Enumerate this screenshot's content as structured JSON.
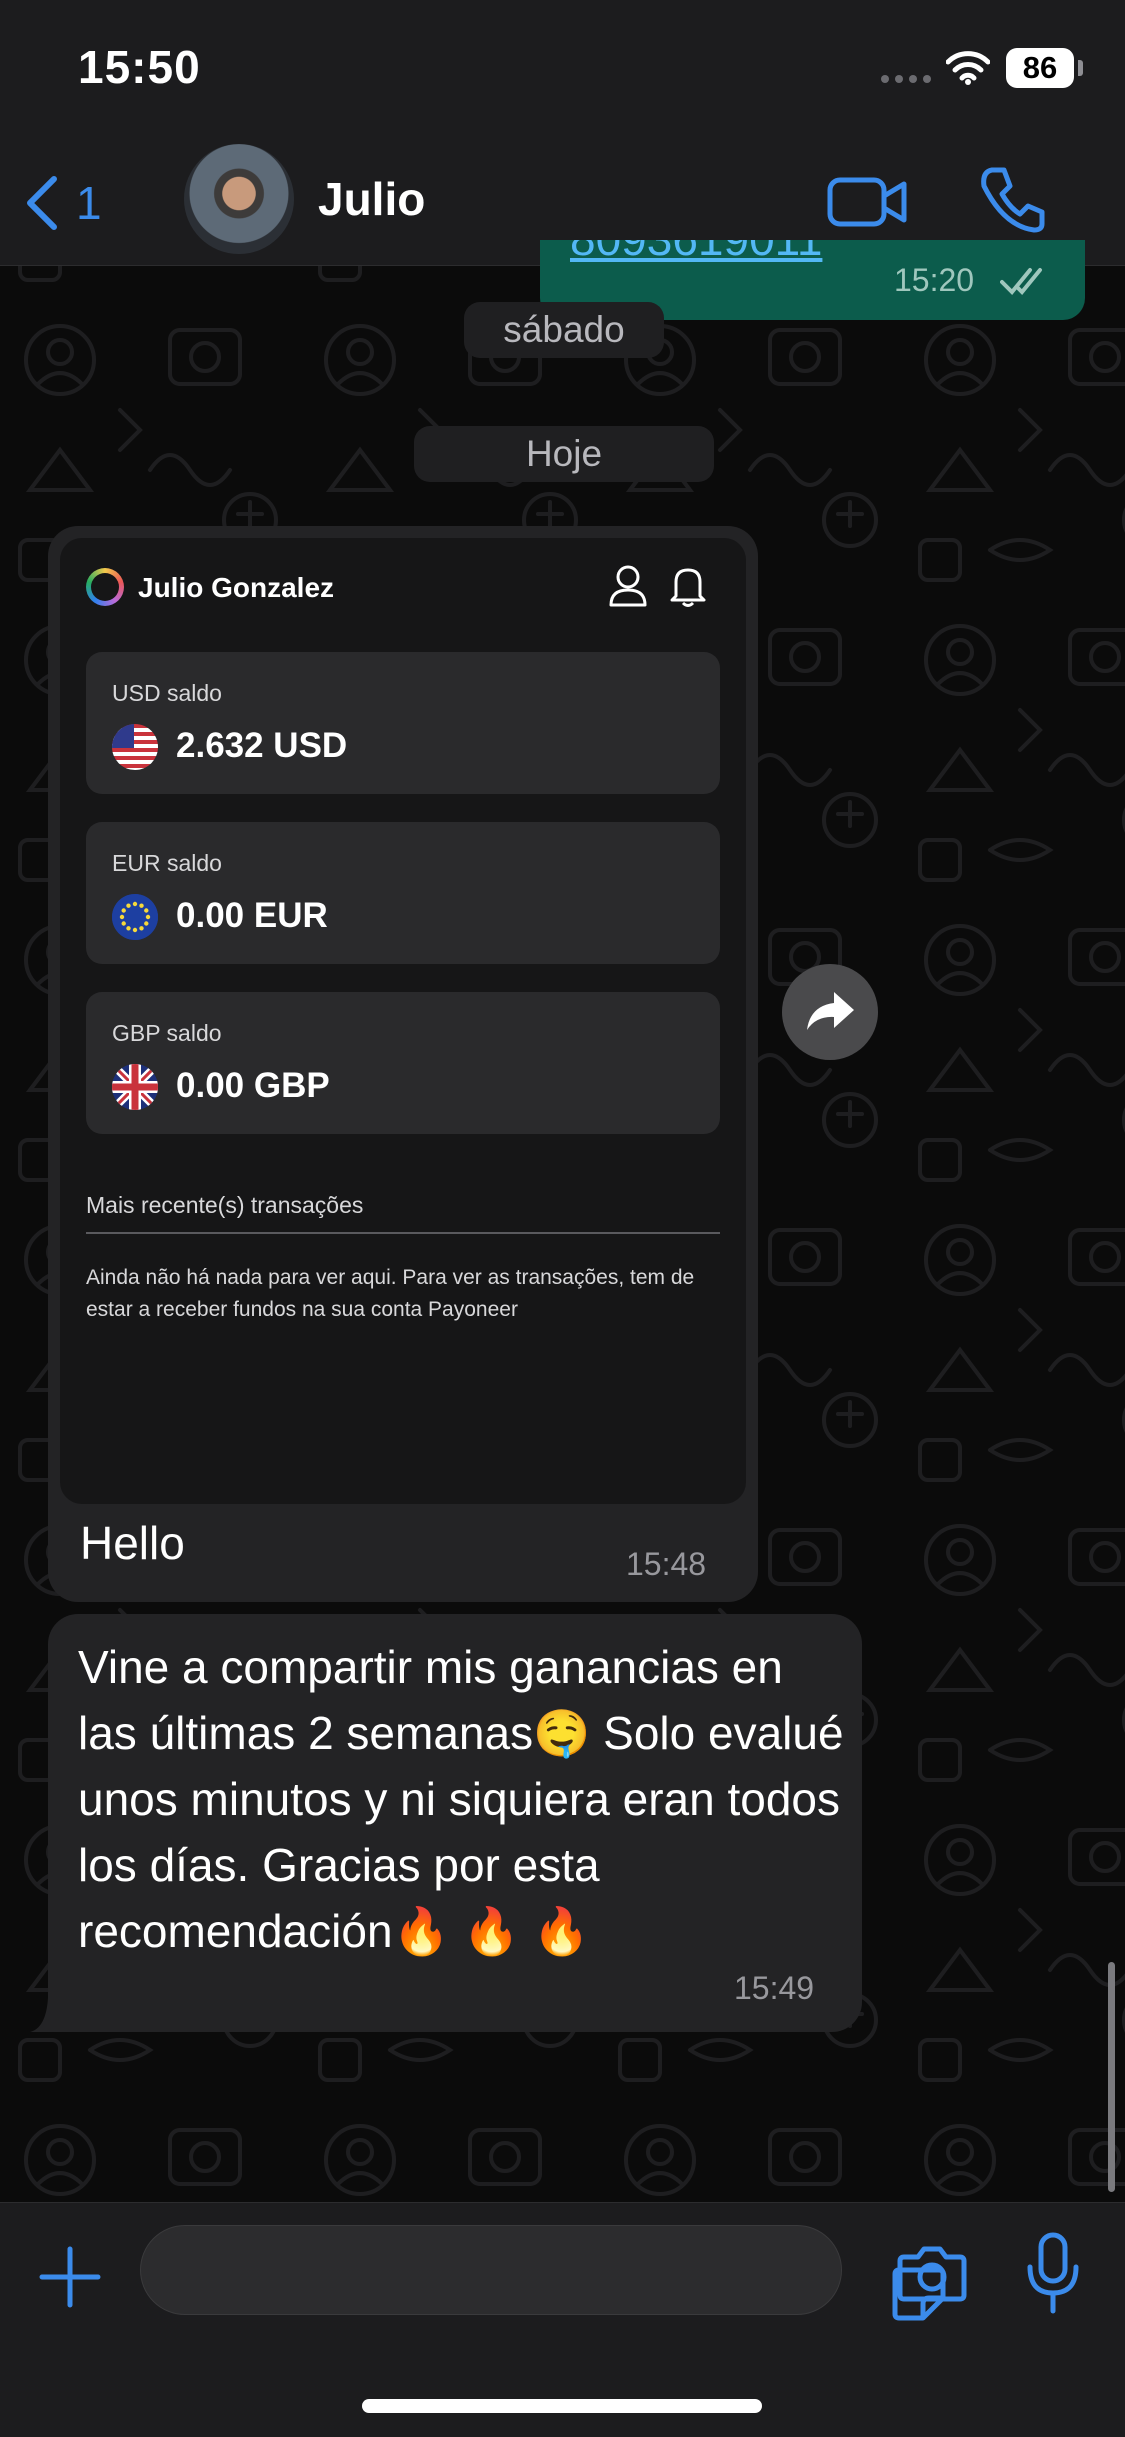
{
  "status_bar": {
    "time": "15:50",
    "battery": "86"
  },
  "header": {
    "back_count": "1",
    "contact_name": "Julio"
  },
  "previous_message": {
    "link_text": "8093619011",
    "time": "15:20"
  },
  "date_separators": [
    "sábado",
    "Hoje"
  ],
  "image_message": {
    "screenshot": {
      "owner_name": "Julio Gonzalez",
      "balances": [
        {
          "label": "USD saldo",
          "amount": "2.632 USD",
          "flag": "us-flag-icon"
        },
        {
          "label": "EUR saldo",
          "amount": "0.00 EUR",
          "flag": "eu-flag-icon"
        },
        {
          "label": "GBP saldo",
          "amount": "0.00 GBP",
          "flag": "gb-flag-icon"
        }
      ],
      "transactions_title": "Mais recente(s) transações",
      "empty_state": "Ainda não há nada para ver aqui. Para ver as transações, tem de estar a receber fundos na sua conta Payoneer"
    },
    "caption": "Hello",
    "time": "15:48"
  },
  "text_message": {
    "text": "Vine a compartir mis ganancias en las últimas 2 semanas🤤 Solo evalué unos minutos y ni siquiera eran todos los días. Gracias por esta recomendación🔥 🔥 🔥",
    "time": "15:49"
  },
  "colors": {
    "accent": "#3b8beb",
    "bubble_incoming": "#232325",
    "bubble_outgoing": "#0c5c4c",
    "bar_background": "#1c1c1e"
  }
}
